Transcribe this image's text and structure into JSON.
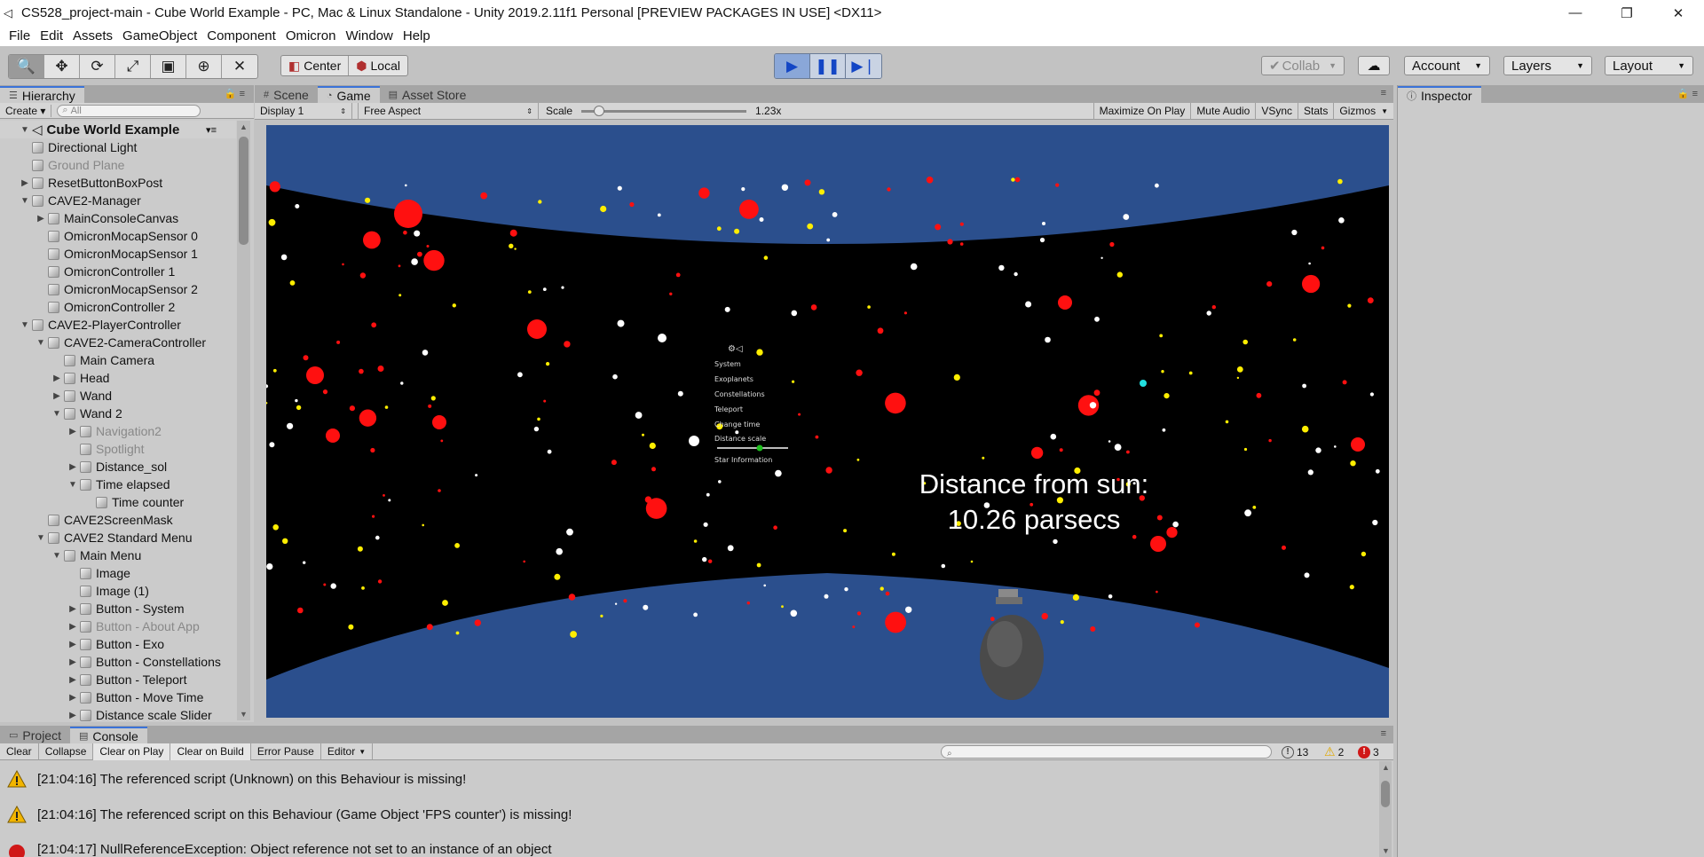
{
  "window": {
    "title": "CS528_project-main - Cube World Example - PC, Mac & Linux Standalone - Unity 2019.2.11f1 Personal [PREVIEW PACKAGES IN USE] <DX11>",
    "minimize": "—",
    "restore": "❐",
    "close": "✕"
  },
  "menu": [
    "File",
    "Edit",
    "Assets",
    "GameObject",
    "Component",
    "Omicron",
    "Window",
    "Help"
  ],
  "toolbar": {
    "tools": [
      "hand-icon",
      "move-icon",
      "rotate-icon",
      "scale-icon",
      "rect-icon",
      "transform-icon",
      "custom-tool-icon"
    ],
    "pivot": "Center",
    "space": "Local",
    "collab": "Collab",
    "account": "Account",
    "layers": "Layers",
    "layout": "Layout"
  },
  "hierarchy": {
    "tab": "Hierarchy",
    "create": "Create",
    "search_placeholder": "All",
    "scene": "Cube World Example",
    "items": [
      {
        "label": "Directional Light",
        "depth": 1,
        "arrow": "",
        "dim": false
      },
      {
        "label": "Ground Plane",
        "depth": 1,
        "arrow": "",
        "dim": true
      },
      {
        "label": "ResetButtonBoxPost",
        "depth": 1,
        "arrow": "▶",
        "dim": false
      },
      {
        "label": "CAVE2-Manager",
        "depth": 1,
        "arrow": "▼",
        "dim": false
      },
      {
        "label": "MainConsoleCanvas",
        "depth": 2,
        "arrow": "▶",
        "dim": false
      },
      {
        "label": "OmicronMocapSensor 0",
        "depth": 2,
        "arrow": "",
        "dim": false
      },
      {
        "label": "OmicronMocapSensor 1",
        "depth": 2,
        "arrow": "",
        "dim": false
      },
      {
        "label": "OmicronController 1",
        "depth": 2,
        "arrow": "",
        "dim": false
      },
      {
        "label": "OmicronMocapSensor 2",
        "depth": 2,
        "arrow": "",
        "dim": false
      },
      {
        "label": "OmicronController 2",
        "depth": 2,
        "arrow": "",
        "dim": false
      },
      {
        "label": "CAVE2-PlayerController",
        "depth": 1,
        "arrow": "▼",
        "dim": false
      },
      {
        "label": "CAVE2-CameraController",
        "depth": 2,
        "arrow": "▼",
        "dim": false
      },
      {
        "label": "Main Camera",
        "depth": 3,
        "arrow": "",
        "dim": false
      },
      {
        "label": "Head",
        "depth": 3,
        "arrow": "▶",
        "dim": false
      },
      {
        "label": "Wand",
        "depth": 3,
        "arrow": "▶",
        "dim": false
      },
      {
        "label": "Wand 2",
        "depth": 3,
        "arrow": "▼",
        "dim": false
      },
      {
        "label": "Navigation2",
        "depth": 4,
        "arrow": "▶",
        "dim": true
      },
      {
        "label": "Spotlight",
        "depth": 4,
        "arrow": "",
        "dim": true
      },
      {
        "label": "Distance_sol",
        "depth": 4,
        "arrow": "▶",
        "dim": false
      },
      {
        "label": "Time elapsed",
        "depth": 4,
        "arrow": "▼",
        "dim": false
      },
      {
        "label": "Time counter",
        "depth": 5,
        "arrow": "",
        "dim": false
      },
      {
        "label": "CAVE2ScreenMask",
        "depth": 2,
        "arrow": "",
        "dim": false
      },
      {
        "label": "CAVE2 Standard Menu",
        "depth": 2,
        "arrow": "▼",
        "dim": false
      },
      {
        "label": "Main Menu",
        "depth": 3,
        "arrow": "▼",
        "dim": false
      },
      {
        "label": "Image",
        "depth": 4,
        "arrow": "",
        "dim": false
      },
      {
        "label": "Image (1)",
        "depth": 4,
        "arrow": "",
        "dim": false
      },
      {
        "label": "Button - System",
        "depth": 4,
        "arrow": "▶",
        "dim": false
      },
      {
        "label": "Button - About App",
        "depth": 4,
        "arrow": "▶",
        "dim": true
      },
      {
        "label": "Button - Exo",
        "depth": 4,
        "arrow": "▶",
        "dim": false
      },
      {
        "label": "Button - Constellations",
        "depth": 4,
        "arrow": "▶",
        "dim": false
      },
      {
        "label": "Button - Teleport",
        "depth": 4,
        "arrow": "▶",
        "dim": false
      },
      {
        "label": "Button - Move Time",
        "depth": 4,
        "arrow": "▶",
        "dim": false
      },
      {
        "label": "Distance scale Slider",
        "depth": 4,
        "arrow": "▶",
        "dim": false
      }
    ]
  },
  "tabs": {
    "scene": "Scene",
    "game": "Game",
    "asset_store": "Asset Store",
    "inspector": "Inspector",
    "project": "Project",
    "console": "Console"
  },
  "game": {
    "display": "Display 1",
    "aspect": "Free Aspect",
    "scale_label": "Scale",
    "scale_value": "1.23x",
    "toggles": [
      "Maximize On Play",
      "Mute Audio",
      "VSync",
      "Stats",
      "Gizmos"
    ],
    "distance_line1": "Distance from sun:",
    "distance_line2": "10.26 parsecs",
    "menu_items": [
      "System",
      "Exoplanets",
      "Constellations",
      "Teleport",
      "Change time",
      "Distance scale",
      "Star Information"
    ],
    "colors": {
      "sky": "#2b4f8d",
      "space": "#000000",
      "red_star": "#ff1010",
      "yellow_star": "#ffee00",
      "white_star": "#ffffff",
      "cyan_star": "#22e0e0"
    }
  },
  "console": {
    "buttons": [
      "Clear",
      "Collapse",
      "Clear on Play",
      "Clear on Build",
      "Error Pause",
      "Editor"
    ],
    "info_count": "13",
    "warn_count": "2",
    "error_count": "3",
    "messages": [
      {
        "type": "warning",
        "text": "[21:04:16] The referenced script (Unknown) on this Behaviour is missing!"
      },
      {
        "type": "warning",
        "text": "[21:04:16] The referenced script on this Behaviour (Game Object 'FPS counter') is missing!"
      },
      {
        "type": "error",
        "text": "[21:04:17] NullReferenceException: Object reference not set to an instance of an object"
      }
    ]
  }
}
